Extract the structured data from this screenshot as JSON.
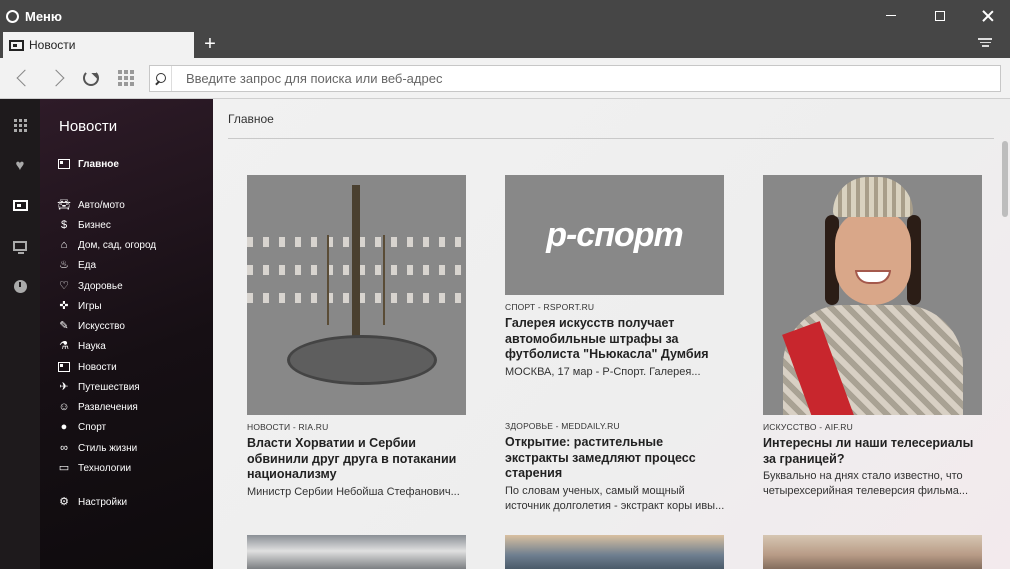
{
  "window": {
    "menu_label": "Меню"
  },
  "tabs": [
    {
      "label": "Новости"
    }
  ],
  "address_bar": {
    "placeholder": "Введите запрос для поиска или веб-адрес",
    "value": ""
  },
  "sidebar": {
    "icons": [
      "apps-icon",
      "heart-icon",
      "news-icon",
      "devices-icon",
      "history-icon"
    ]
  },
  "news_menu": {
    "title": "Новости",
    "main_item": "Главное",
    "categories": [
      "Авто/мото",
      "Бизнес",
      "Дом, сад, огород",
      "Еда",
      "Здоровье",
      "Игры",
      "Искусство",
      "Наука",
      "Новости",
      "Путешествия",
      "Развлечения",
      "Спорт",
      "Стиль жизни",
      "Технологии"
    ],
    "settings": "Настройки"
  },
  "main": {
    "section_title": "Главное",
    "cards": [
      {
        "source": "НОВОСТИ - RIA.RU",
        "headline": "Власти Хорватии и Сербии обвинили друг друга в потакании национализму",
        "snippet": "Министр Сербии Небойша Стефанович..."
      },
      {
        "source": "СПОРТ - RSPORT.RU",
        "headline": "Галерея искусств получает автомобильные штрафы за футболиста \"Ньюкасла\" Думбия",
        "snippet": "МОСКВА, 17 мар - Р-Спорт. Галерея...",
        "logo_text": "р-спорт"
      },
      {
        "source": "ЗДОРОВЬЕ - MEDDAILY.RU",
        "headline": "Открытие: растительные экстракты замедляют процесс старения",
        "snippet": "По словам ученых, самый мощный источник долголетия - экстракт коры ивы..."
      },
      {
        "source": "ИСКУССТВО - AIF.RU",
        "headline": "Интересны ли наши телесериалы за границей?",
        "snippet": "Буквально на днях стало известно, что четырехсерийная телеверсия фильма..."
      }
    ]
  },
  "colors": {
    "titlebar": "#464646",
    "sport_green": "#13a04a",
    "sidebar_bg": "#1e1a1c"
  }
}
